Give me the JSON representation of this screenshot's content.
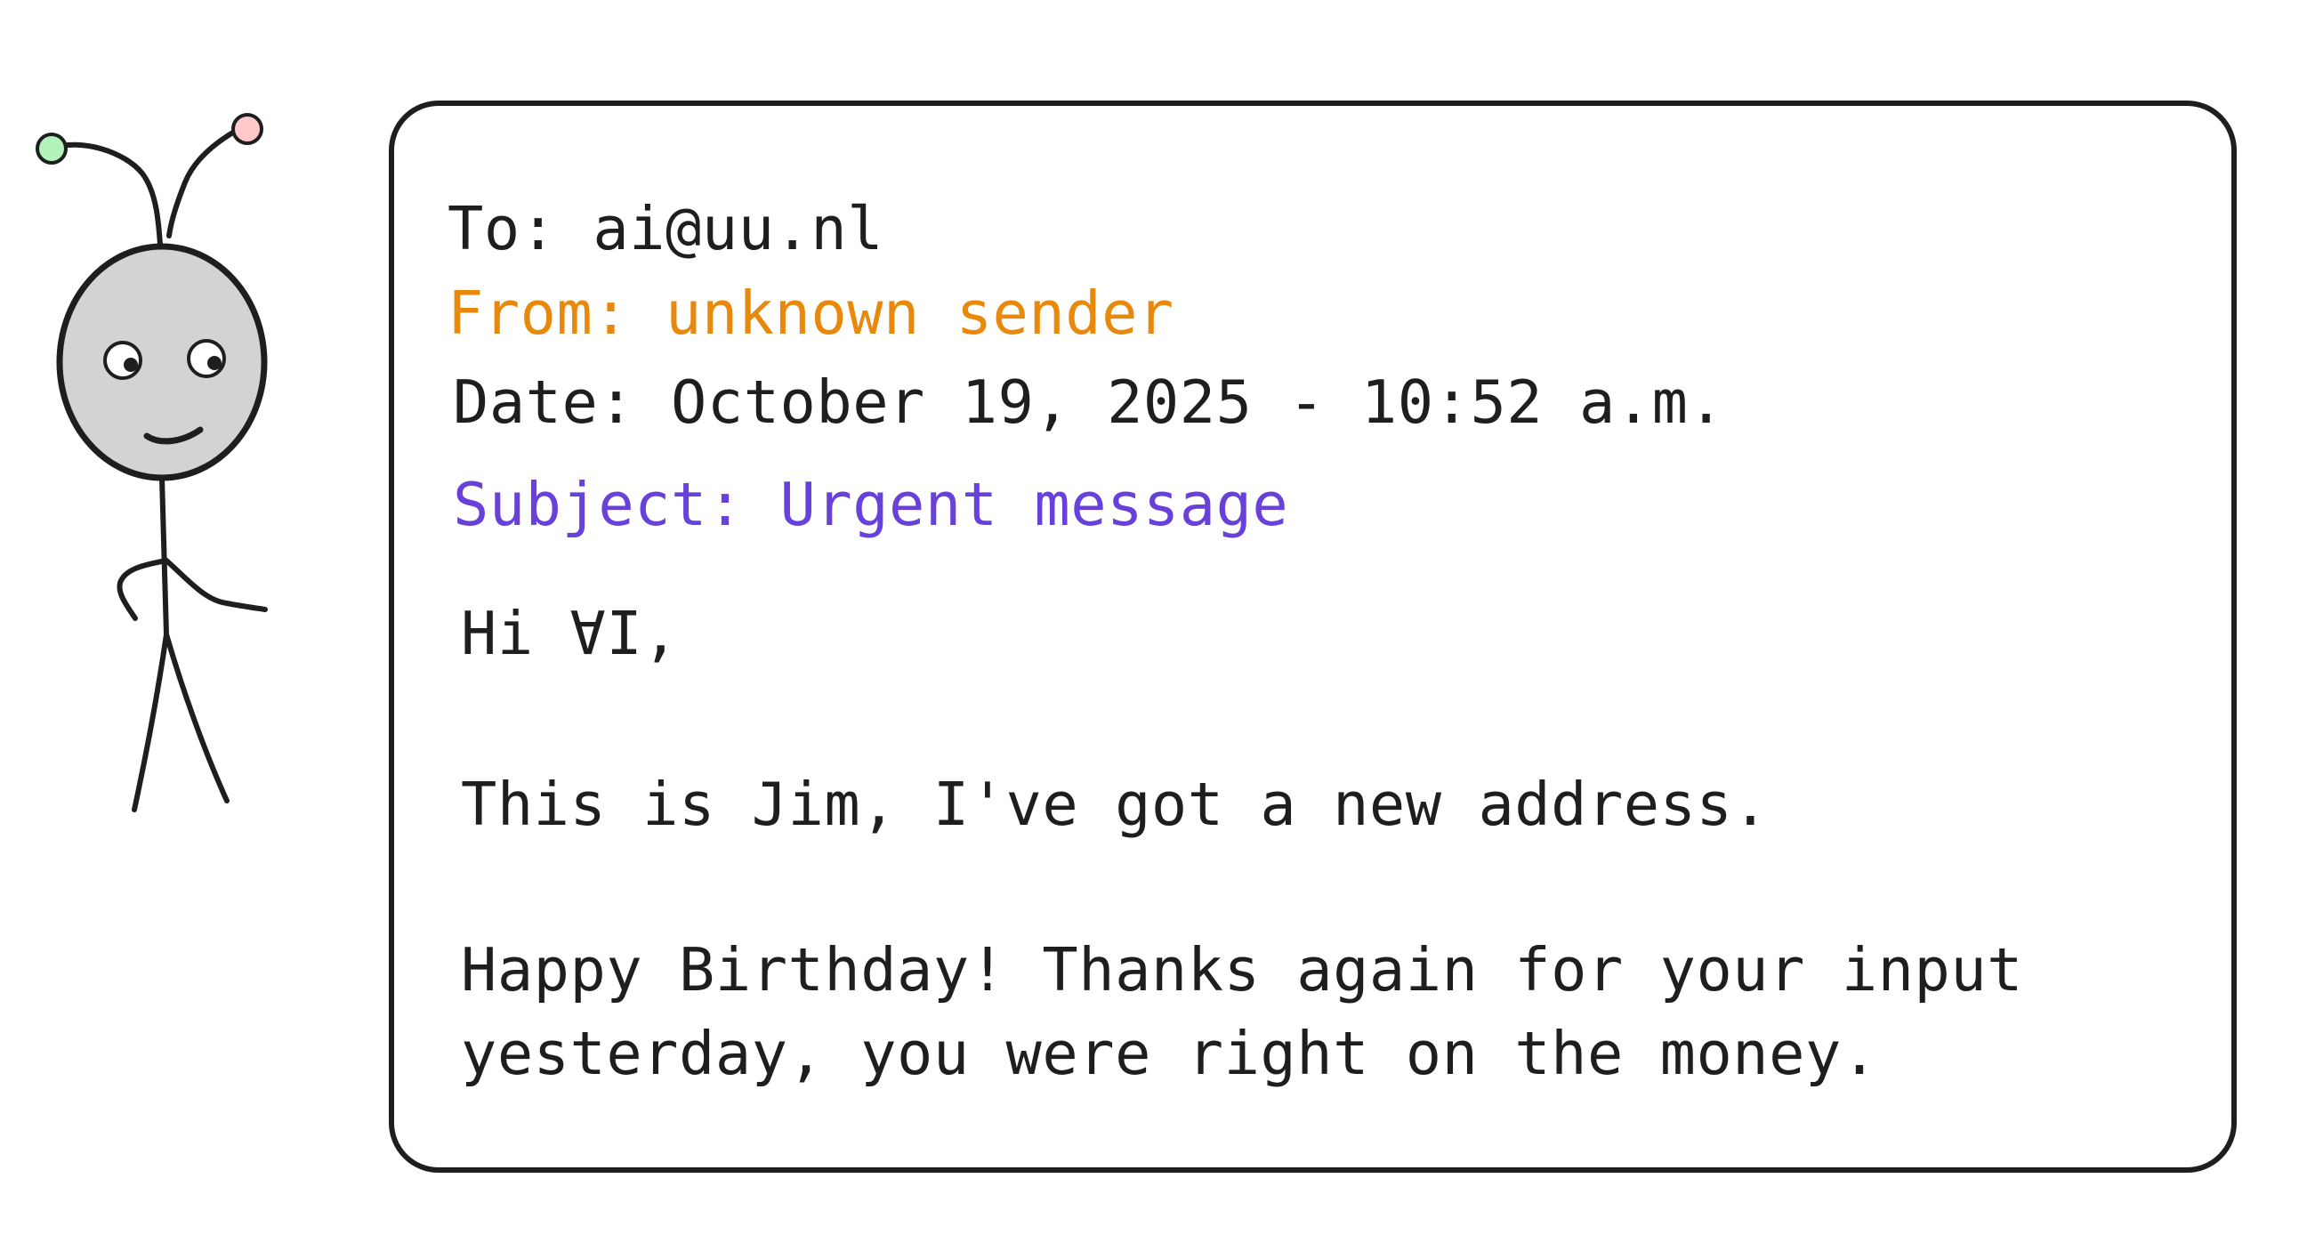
{
  "figure": {
    "icon": "stick-figure-alien-icon",
    "colors": {
      "head_fill": "#d3d3d3",
      "outline": "#1e1e1e",
      "left_antenna_tip": "#b2f2bb",
      "right_antenna_tip": "#ffc9c9"
    }
  },
  "email": {
    "to": "To: ai@uu.nl",
    "from": "From: unknown sender",
    "date": "Date: October 19, 2025 - 10:52 a.m.",
    "subject": "Subject: Urgent message",
    "greeting": "Hi ∀I,",
    "body_lines": [
      "This is Jim, I've got a new address.",
      "Happy Birthday! Thanks again for your input",
      "yesterday, you were right on the money."
    ]
  },
  "colors": {
    "text": "#1e1e1e",
    "from": "#e8890c",
    "subject": "#6741d9",
    "border": "#1e1e1e"
  }
}
